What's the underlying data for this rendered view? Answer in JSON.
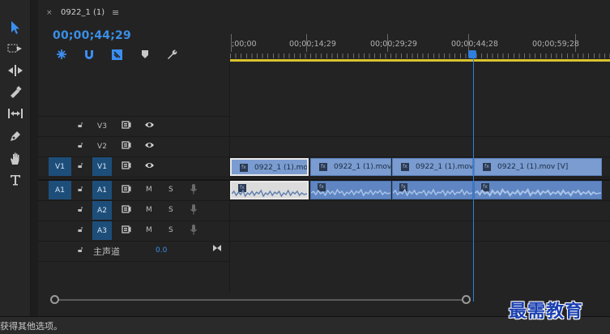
{
  "sequence": {
    "tab_close": "×",
    "tab_title": "0922_1 (1)",
    "tab_menu": "≡",
    "timecode": "00;00;44;29"
  },
  "ruler": {
    "labels": [
      ";00;00",
      "00;00;14;29",
      "00;00;29;29",
      "00;00;44;28",
      "00;00;59;28"
    ]
  },
  "tracks": {
    "v3": {
      "name": "V3"
    },
    "v2": {
      "name": "V2"
    },
    "v1": {
      "source": "V1",
      "name": "V1"
    },
    "a1": {
      "source": "A1",
      "name": "A1",
      "mute": "M",
      "solo": "S"
    },
    "a2": {
      "name": "A2",
      "mute": "M",
      "solo": "S"
    },
    "a3": {
      "name": "A3",
      "mute": "M",
      "solo": "S"
    },
    "master": {
      "name": "主声道",
      "value": "0.0"
    }
  },
  "clips": {
    "video": [
      "0922_1 (1).mov",
      "0922_1 (1).mov [",
      "0922_1 (1).mov [",
      "0922_1 (1).mov [V]"
    ],
    "fx_badge": "fx"
  },
  "status": {
    "text": "获得其他选项。"
  },
  "watermark": "最需教育",
  "colors": {
    "accent": "#2f7fdc",
    "target_track": "#1d4e7a",
    "video_clip": "#7a9cd0",
    "audio_clip": "#5f86c2",
    "work_area": "#d9c32e"
  }
}
